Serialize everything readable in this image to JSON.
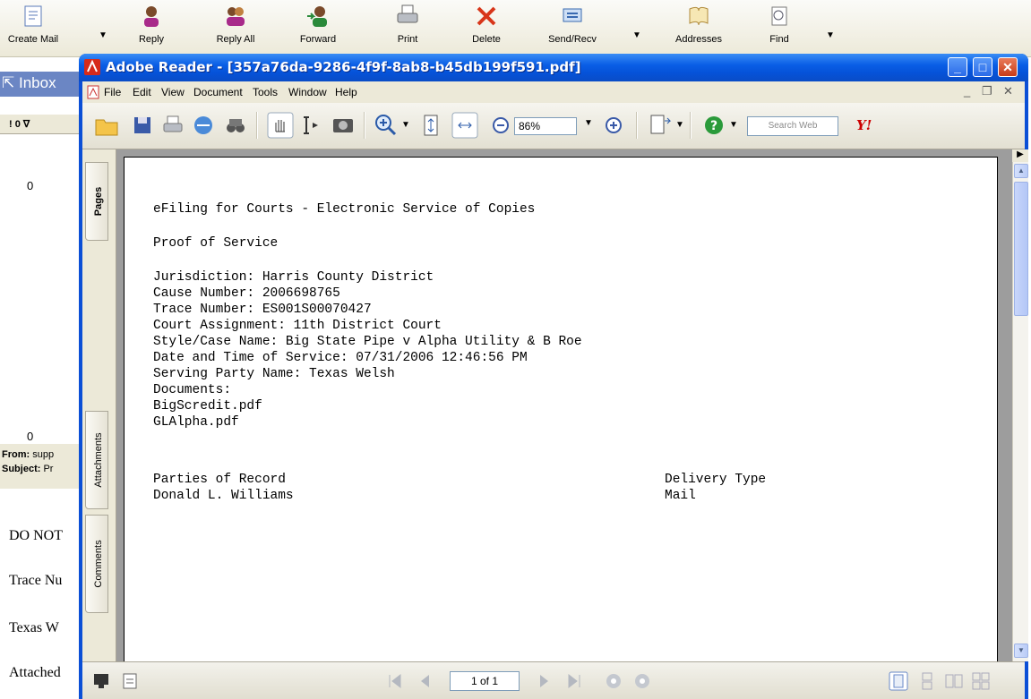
{
  "outlook": {
    "toolbar": [
      {
        "label": "Create Mail",
        "icon": "create-mail-icon"
      },
      {
        "label": "Reply",
        "icon": "reply-icon"
      },
      {
        "label": "Reply All",
        "icon": "reply-all-icon"
      },
      {
        "label": "Forward",
        "icon": "forward-icon"
      },
      {
        "label": "Print",
        "icon": "printer-icon"
      },
      {
        "label": "Delete",
        "icon": "delete-icon"
      },
      {
        "label": "Send/Recv",
        "icon": "send-receive-icon"
      },
      {
        "label": "Addresses",
        "icon": "address-book-icon"
      },
      {
        "label": "Find",
        "icon": "find-icon"
      }
    ],
    "folder_title": "Inbox",
    "column_headers": "! 0 ∇",
    "attachment_glyph": "0",
    "preview_from_label": "From:",
    "preview_from_value": "supp",
    "preview_subject_label": "Subject:",
    "preview_subject_value": "Pr",
    "body_lines": [
      "DO NOT",
      "Trace Nu",
      "Texas W",
      "Attached"
    ]
  },
  "reader": {
    "title": "Adobe Reader - [357a76da-9286-4f9f-8ab8-b45db199f591.pdf]",
    "menu": [
      "File",
      "Edit",
      "View",
      "Document",
      "Tools",
      "Window",
      "Help"
    ],
    "zoom": "86%",
    "search_placeholder": "Search Web",
    "yahoo_logo": "Y!",
    "side_tabs": [
      "Pages",
      "Attachments",
      "Comments"
    ],
    "page_indicator": "1 of 1",
    "colors": {
      "titlebar": "#0a5ee6",
      "chrome": "#ece9d8",
      "doc_bg": "#9d9d9d"
    }
  },
  "document": {
    "heading": "eFiling for Courts - Electronic Service of Copies",
    "subheading": "Proof of Service",
    "fields": [
      "Jurisdiction: Harris County District",
      "Cause Number: 2006698765",
      "Trace Number: ES001S00070427",
      "Court Assignment: 11th District Court",
      "Style/Case Name: Big State Pipe v Alpha Utility & B Roe",
      "Date and Time of Service: 07/31/2006 12:46:56 PM",
      "Serving Party Name: Texas Welsh",
      "Documents:",
      "BigScredit.pdf",
      "GLAlpha.pdf"
    ],
    "parties_header": "Parties of Record",
    "delivery_header": "Delivery Type",
    "party_name": "Donald L. Williams",
    "delivery_type": "Mail"
  }
}
